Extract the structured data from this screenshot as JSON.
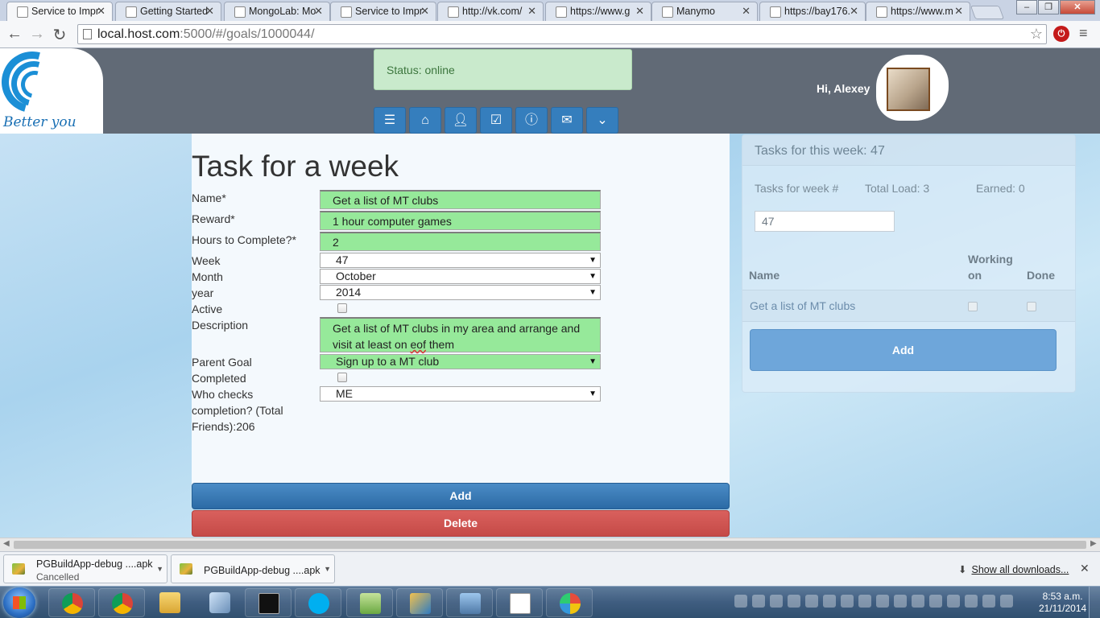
{
  "browser": {
    "tabs": [
      {
        "title": "Service to Impr",
        "active": true
      },
      {
        "title": "Getting Started",
        "active": false
      },
      {
        "title": "MongoLab: Mo",
        "active": false
      },
      {
        "title": "Service to Impr",
        "active": false
      },
      {
        "title": "http://vk.com/",
        "active": false
      },
      {
        "title": "https://www.g",
        "active": false
      },
      {
        "title": "Manymo",
        "active": false
      },
      {
        "title": "https://bay176.",
        "active": false
      },
      {
        "title": "https://www.m",
        "active": false
      }
    ],
    "url_host": "local.host.com",
    "url_rest": ":5000/#/goals/1000044/",
    "window_buttons": [
      "minimize",
      "maximize",
      "close"
    ]
  },
  "header": {
    "logo_text": "Better you",
    "status": "Status: online",
    "greeting": "Hi, Alexey",
    "nav_icons": [
      "list-icon",
      "home-icon",
      "user-icon",
      "checklist-icon",
      "info-icon",
      "mail-icon",
      "chevron-down-icon"
    ]
  },
  "form": {
    "title": "Task for a week",
    "labels": {
      "name": "Name*",
      "reward": "Reward*",
      "hours": "Hours to Complete?*",
      "week": "Week",
      "month": "Month",
      "year": "year",
      "active": "Active",
      "description": "Description",
      "parent_goal": "Parent Goal",
      "completed": "Completed",
      "who_checks": "Who checks completion? (Total Friends):206"
    },
    "values": {
      "name": "Get a list of MT clubs",
      "reward": "1 hour computer games",
      "hours": "2",
      "week": "47",
      "month": "October",
      "year": "2014",
      "description_pre": "Get a list of MT clubs in my area and arrange and visit at least on ",
      "description_misspelt": "eof",
      "description_post": " them",
      "parent_goal": "Sign up to a MT club",
      "who_checks": "ME"
    },
    "buttons": {
      "add": "Add",
      "delete": "Delete"
    }
  },
  "week_panel": {
    "title": "Tasks for this week: 47",
    "stats": {
      "tasks_for_week_label": "Tasks for week #",
      "total_load": "Total Load: 3",
      "earned": "Earned: 0"
    },
    "week_input": "47",
    "table": {
      "columns": {
        "name": "Name",
        "working_on": "Working on",
        "done": "Done"
      },
      "rows": [
        {
          "name": "Get a list of MT clubs",
          "working_on": false,
          "done": false
        }
      ]
    },
    "add_button": "Add"
  },
  "downloads": {
    "items": [
      {
        "name": "PGBuildApp-debug ....apk",
        "status": "Cancelled"
      },
      {
        "name": "PGBuildApp-debug ....apk",
        "status": ""
      }
    ],
    "show_all": "Show all downloads..."
  },
  "taskbar": {
    "time": "8:53 a.m.",
    "date": "21/11/2014"
  }
}
